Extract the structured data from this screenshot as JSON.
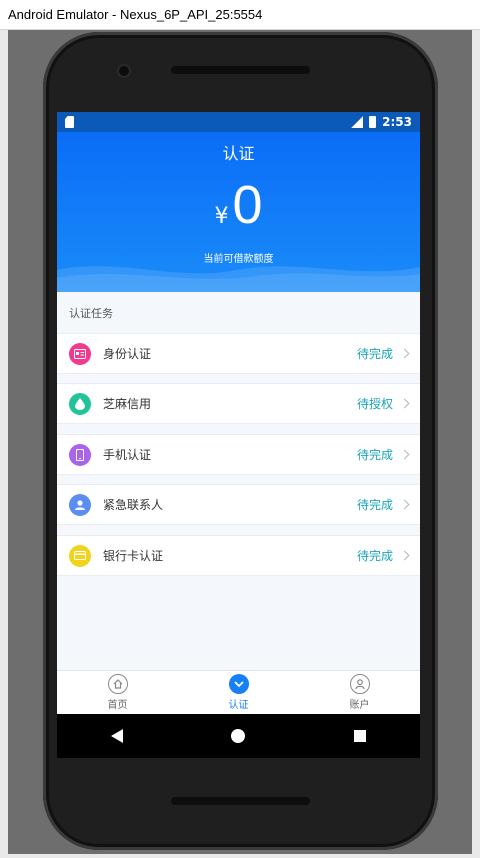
{
  "window": {
    "title": "Android Emulator - Nexus_6P_API_25:5554"
  },
  "statusbar": {
    "network": "4G",
    "time": "2:53"
  },
  "header": {
    "title": "认证",
    "currency": "¥",
    "amount": "0",
    "caption": "当前可借款额度"
  },
  "section": {
    "label": "认证任务"
  },
  "tasks": [
    {
      "label": "身份认证",
      "status": "待完成",
      "icon": "id-card-icon",
      "color": "#f2398e"
    },
    {
      "label": "芝麻信用",
      "status": "待授权",
      "icon": "sesame-icon",
      "color": "#22c29a"
    },
    {
      "label": "手机认证",
      "status": "待完成",
      "icon": "phone-icon",
      "color": "#a964e8"
    },
    {
      "label": "紧急联系人",
      "status": "待完成",
      "icon": "contact-icon",
      "color": "#5b8ef2"
    },
    {
      "label": "银行卡认证",
      "status": "待完成",
      "icon": "bank-card-icon",
      "color": "#f3d21b"
    }
  ],
  "tabs": [
    {
      "label": "首页",
      "icon": "home-icon"
    },
    {
      "label": "认证",
      "icon": "verify-icon"
    },
    {
      "label": "账户",
      "icon": "account-icon"
    }
  ],
  "colors": {
    "primary": "#1680f6",
    "status_teal": "#1aa3b8"
  }
}
